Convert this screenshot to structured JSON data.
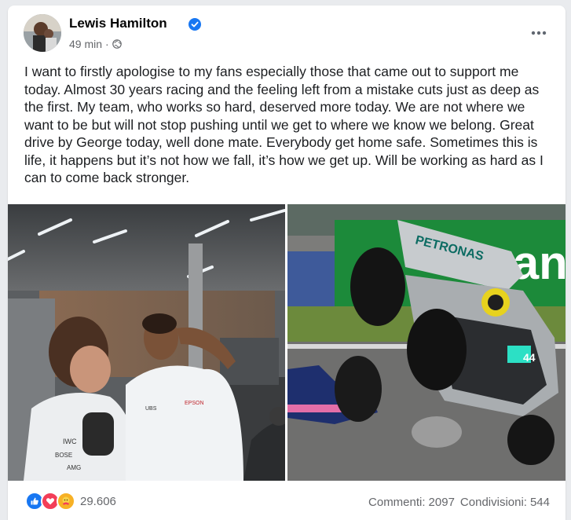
{
  "post": {
    "author": "Lewis Hamilton",
    "time": "49 min",
    "separator": "·",
    "text": "I want to firstly apologise to my fans especially those that came out to support me today. Almost 30 years racing and the feeling left from a mistake cuts just as deep as the first. My team, who works so hard, deserved more today. We are not where we want to be but will not stop pushing until we get to where we know we belong. Great drive by George today, well done mate. Everybody get home safe. Sometimes this is life, it happens but it’s not how we fall, it’s how we get up. Will be working as hard as I can to come back stronger."
  },
  "photos": {
    "left_shirt_text_1": "IWC",
    "left_shirt_text_2": "BOSE",
    "left_shirt_text_3": "AMG",
    "left_shirt_text_4": "UBS",
    "left_shirt_text_5": "EPSON",
    "right_wing_text": "PETRONAS",
    "right_banner_text": "aran",
    "right_car_number": "44"
  },
  "footer": {
    "reaction_count": "29.606",
    "comments_label": "Commenti:",
    "comments_count": "2097",
    "shares_label": "Condivisioni:",
    "shares_count": "544"
  },
  "icons": {
    "verified": "verified-badge-icon",
    "globe": "globe-icon",
    "more": "more-options-icon",
    "like": "like-reaction-icon",
    "love": "love-reaction-icon",
    "care": "care-reaction-icon"
  },
  "colors": {
    "facebook_blue": "#1877f2",
    "love_red": "#f33e58",
    "care_yellow": "#f7b125",
    "meta_gray": "#65676b"
  }
}
